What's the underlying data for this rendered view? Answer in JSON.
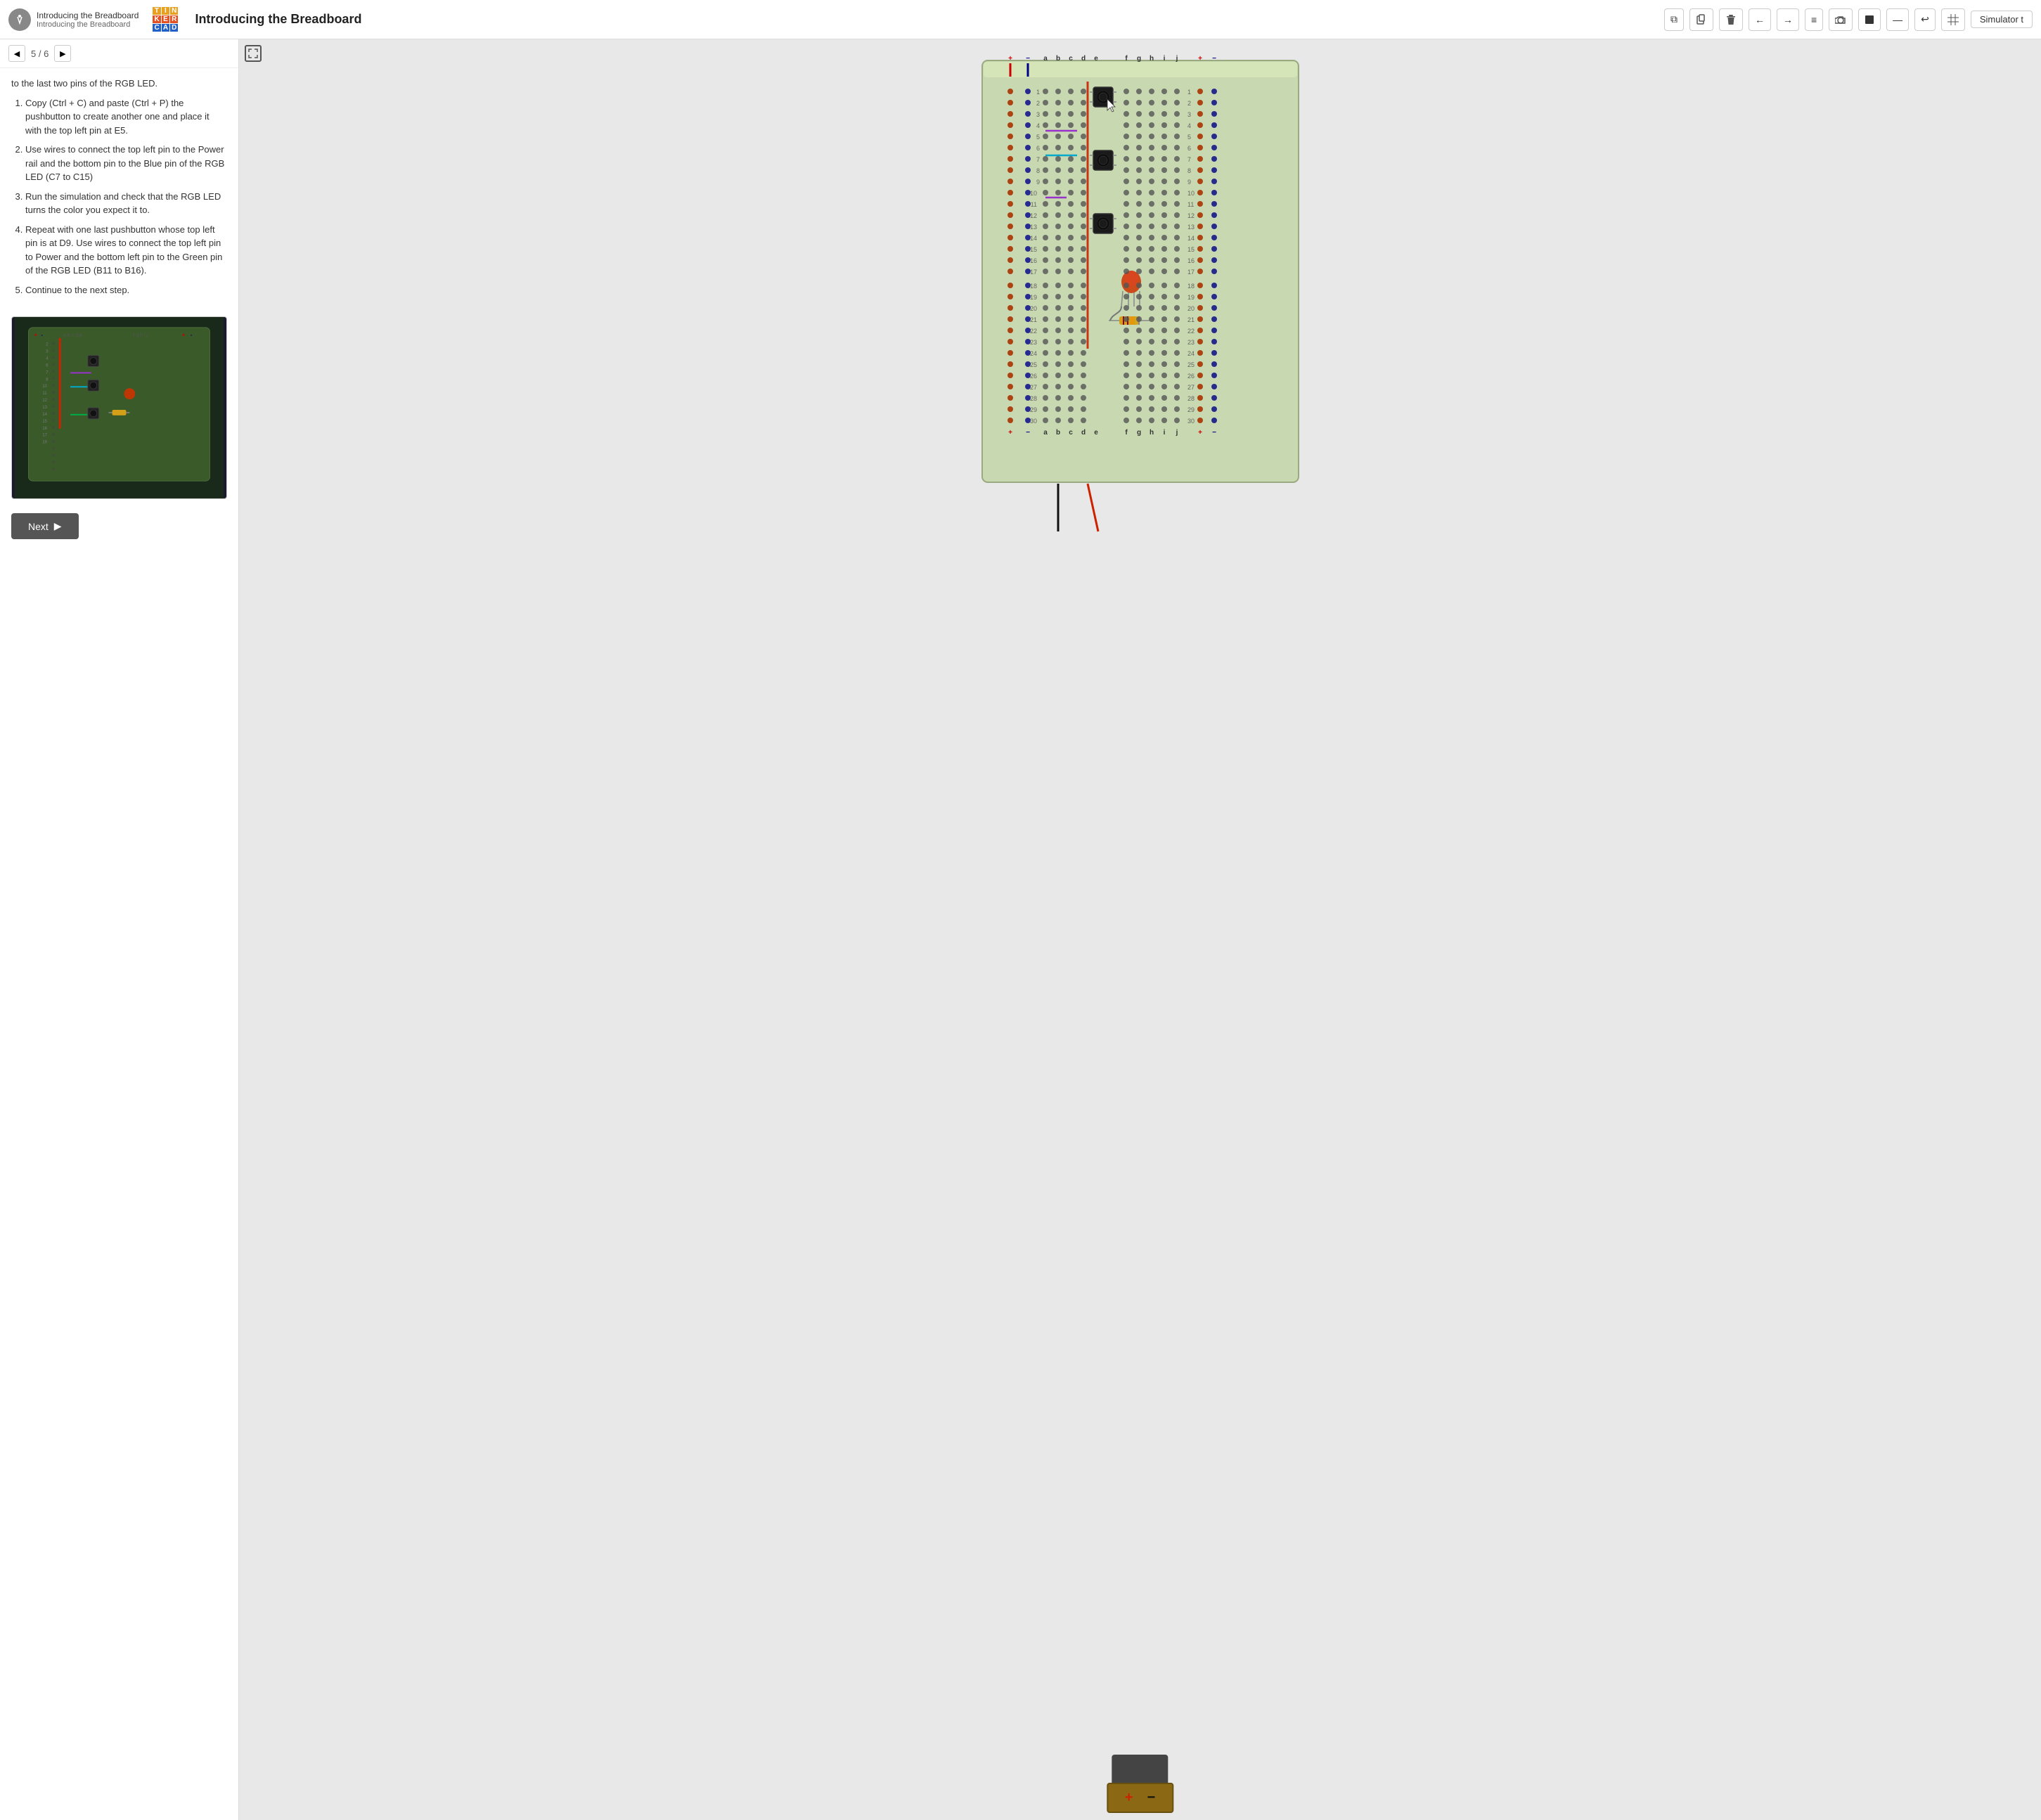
{
  "header": {
    "app_icon_label": "TC",
    "breadcrumb_main": "Introducing the Breadboard",
    "breadcrumb_sub": "Introducing the Breadboard",
    "tinkercad_letters": [
      "T",
      "I",
      "N",
      "K",
      "E",
      "R",
      "C",
      "A",
      "D"
    ],
    "page_title": "Introducing the Breadboard",
    "simulator_label": "Simulator t"
  },
  "nav": {
    "prev_label": "◀",
    "page_counter": "5 / 6",
    "next_label": "▶"
  },
  "toolbar": {
    "copy_icon": "⧉",
    "paste_icon": "📋",
    "delete_icon": "🗑",
    "back_icon": "←",
    "forward_icon": "→",
    "list_icon": "≡",
    "camera_icon": "⊙",
    "stop_icon": "■",
    "line_icon": "—",
    "undo_icon": "↩",
    "grid_icon": "⊞"
  },
  "instructions": {
    "intro_text": "to the last two pins of the RGB LED.",
    "steps": [
      "Copy (Ctrl + C) and paste (Ctrl + P) the pushbutton to create another one and place it with the top left pin at E5.",
      "Use wires to connect the top left pin to the Power rail and the bottom pin to the Blue pin of the RGB LED (C7 to C15)",
      "Run the simulation and check that the RGB LED turns the color you expect it to.",
      "Repeat with one last pushbutton whose top left pin is at D9. Use wires to connect the top left pin to Power and the bottom left pin to the Green pin of the RGB LED (B11 to B16).",
      "Continue to the next step."
    ]
  },
  "next_button": {
    "label": "Next",
    "arrow": "▶"
  },
  "breadboard": {
    "column_labels_left": [
      "+",
      "-",
      "a",
      "b",
      "c",
      "d",
      "e"
    ],
    "column_labels_right": [
      "f",
      "g",
      "h",
      "i",
      "j",
      "+",
      "-"
    ],
    "row_count": 30,
    "rows": [
      1,
      2,
      3,
      4,
      5,
      6,
      7,
      8,
      9,
      10,
      11,
      12,
      13,
      14,
      15,
      16,
      17,
      18,
      19,
      20,
      21,
      22,
      23,
      24,
      25,
      26,
      27,
      28,
      29,
      30
    ],
    "power_plus": "+",
    "power_minus": "-"
  }
}
